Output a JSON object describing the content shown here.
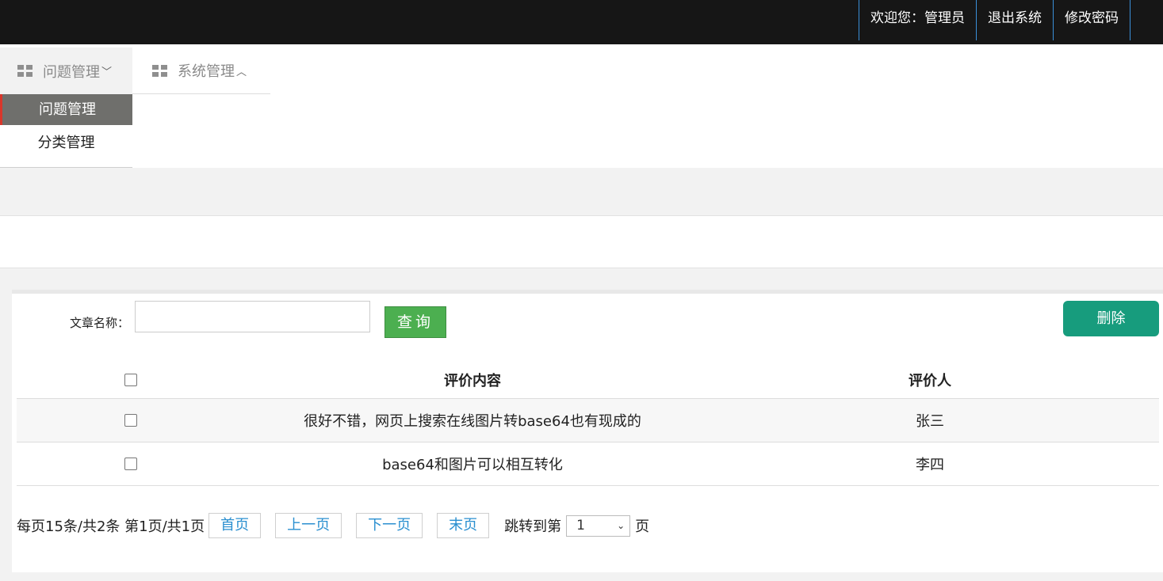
{
  "header": {
    "links": [
      {
        "label": "欢迎您：管理员"
      },
      {
        "label": "退出系统"
      },
      {
        "label": "修改密码"
      }
    ]
  },
  "nav": {
    "tabs": [
      {
        "label": "问题管理",
        "chevron": "chevron-down",
        "icon": "grid-icon"
      },
      {
        "label": "系统管理",
        "chevron": "chevron-up",
        "icon": "grid-icon"
      }
    ],
    "submenu": [
      {
        "label": "问题管理",
        "active": true
      },
      {
        "label": "分类管理",
        "active": false
      }
    ]
  },
  "search": {
    "label": "文章名称：",
    "value": "",
    "placeholder": "",
    "query_label": "查询",
    "delete_label": "删除"
  },
  "table": {
    "columns": [
      "评价内容",
      "评价人"
    ],
    "rows": [
      {
        "content": "很好不错，网页上搜索在线图片转base64也有现成的",
        "reviewer": "张三"
      },
      {
        "content": "base64和图片可以相互转化",
        "reviewer": "李四"
      }
    ]
  },
  "pager": {
    "summary": "每页15条/共2条 第1页/共1页",
    "first": "首页",
    "prev": "上一页",
    "next": "下一页",
    "last": "末页",
    "jump_label": "跳转到第",
    "jump_value": "1",
    "unit": "页"
  },
  "colors": {
    "topbar": "#161616",
    "topbar_divider": "#3a8fd9",
    "active_menu_bg": "#6f6f6c",
    "active_menu_accent": "#d9362b",
    "query_button": "#4caf50",
    "delete_button": "#179c7d",
    "pager_link": "#2a8fd0"
  }
}
